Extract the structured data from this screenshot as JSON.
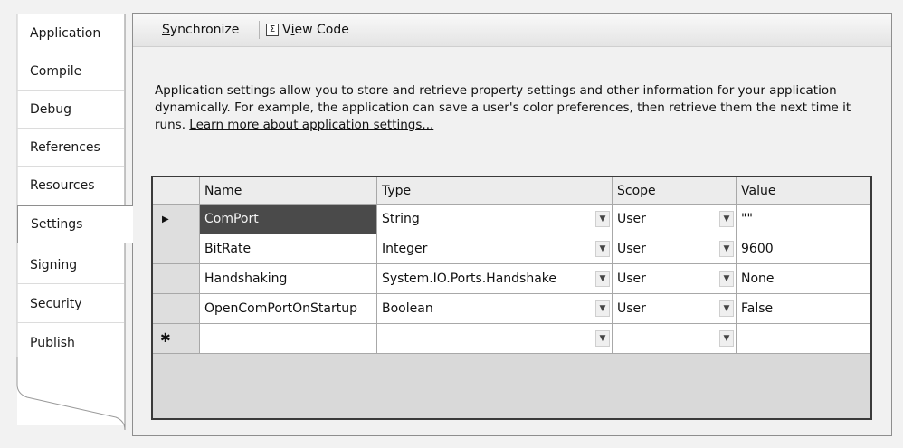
{
  "tabs": [
    {
      "label": "Application",
      "selected": false
    },
    {
      "label": "Compile",
      "selected": false
    },
    {
      "label": "Debug",
      "selected": false
    },
    {
      "label": "References",
      "selected": false
    },
    {
      "label": "Resources",
      "selected": false
    },
    {
      "label": "Settings",
      "selected": true
    },
    {
      "label": "Signing",
      "selected": false
    },
    {
      "label": "Security",
      "selected": false
    },
    {
      "label": "Publish",
      "selected": false
    }
  ],
  "toolbar": {
    "sync_label": "Synchronize",
    "sync_mnemonic": "S",
    "sync_rest": "ynchronize",
    "viewcode_pre": "V",
    "viewcode_mnemonic": "i",
    "viewcode_rest": "ew Code",
    "viewcode_icon": "code-icon"
  },
  "description": {
    "text": "Application settings allow you to store and retrieve property settings and other information for your application dynamically. For example, the application can save a user's color preferences, then retrieve them the next time it runs. ",
    "link": "Learn more about application settings..."
  },
  "grid": {
    "columns": [
      "Name",
      "Type",
      "Scope",
      "Value"
    ],
    "rows": [
      {
        "name": "ComPort",
        "type": "String",
        "scope": "User",
        "value": "\"\"",
        "current": true
      },
      {
        "name": "BitRate",
        "type": "Integer",
        "scope": "User",
        "value": "9600",
        "current": false
      },
      {
        "name": "Handshaking",
        "type": "System.IO.Ports.Handshake",
        "scope": "User",
        "value": "None",
        "current": false
      },
      {
        "name": "OpenComPortOnStartup",
        "type": "Boolean",
        "scope": "User",
        "value": "False",
        "current": false
      }
    ],
    "current_row_marker": "▶",
    "new_row_marker": "✱"
  },
  "colors": {
    "selected_cell_bg": "#4a4a4a",
    "grid_border": "#3a3a3a",
    "panel_bg": "#f1f1f1"
  }
}
